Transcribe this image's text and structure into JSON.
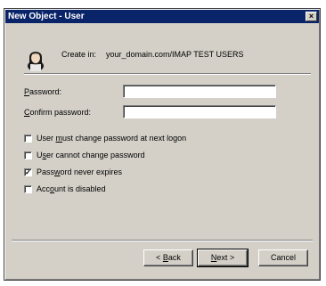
{
  "window": {
    "title": "New Object - User",
    "close_glyph": "×"
  },
  "header": {
    "icon": "user-icon",
    "create_in_label": "Create in:",
    "create_in_value": "your_domain.com/IMAP TEST USERS"
  },
  "fields": {
    "password": {
      "label_pre": "",
      "label_key": "P",
      "label_post": "assword:",
      "value": ""
    },
    "confirm": {
      "label_pre": "",
      "label_key": "C",
      "label_post": "onfirm password:",
      "value": ""
    }
  },
  "options": [
    {
      "pre": "User ",
      "key": "m",
      "post": "ust change password at next logon",
      "checked": false
    },
    {
      "pre": "U",
      "key": "s",
      "post": "er cannot change password",
      "checked": false
    },
    {
      "pre": "Pass",
      "key": "w",
      "post": "ord never expires",
      "checked": true
    },
    {
      "pre": "Acc",
      "key": "o",
      "post": "unt is disabled",
      "checked": false
    }
  ],
  "check_mark": "✓",
  "buttons": {
    "back": {
      "pre": "< ",
      "key": "B",
      "post": "ack"
    },
    "next": {
      "pre": "",
      "key": "N",
      "post": "ext >"
    },
    "cancel": {
      "label": "Cancel"
    }
  },
  "colors": {
    "face": "#d4d0c8",
    "titlebar": "#0a246a",
    "title_text": "#ffffff"
  }
}
